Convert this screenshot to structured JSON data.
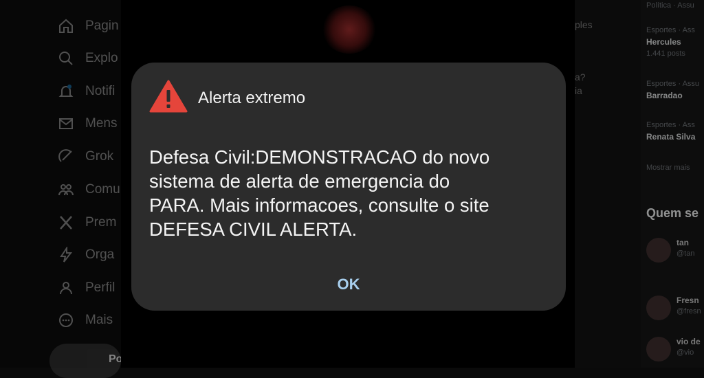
{
  "background": {
    "nav": [
      {
        "label": "Pagin",
        "icon": "home-icon"
      },
      {
        "label": "Explo",
        "icon": "search-icon"
      },
      {
        "label": "Notifi",
        "icon": "bell-icon"
      },
      {
        "label": "Mens",
        "icon": "mail-icon"
      },
      {
        "label": "Grok",
        "icon": "grok-icon"
      },
      {
        "label": "Comu",
        "icon": "communities-icon"
      },
      {
        "label": "Prem",
        "icon": "x-logo-icon"
      },
      {
        "label": "Orga",
        "icon": "lightning-icon"
      },
      {
        "label": "Perfil",
        "icon": "profile-icon"
      },
      {
        "label": "Mais",
        "icon": "more-icon"
      }
    ],
    "post_button_label": "Po",
    "mid_fragments": [
      "ples",
      "a?",
      "ia"
    ],
    "trends": [
      {
        "meta": "Política · Assu",
        "name": "",
        "count": ""
      },
      {
        "meta": "Esportes · Ass",
        "name": "Hercules",
        "count": "1.441 posts"
      },
      {
        "meta": "Esportes · Assu",
        "name": "Barradao",
        "count": ""
      },
      {
        "meta": "Esportes · Ass",
        "name": "Renata Silva",
        "count": ""
      },
      {
        "meta": "Mostrar mais",
        "name": "",
        "count": ""
      }
    ],
    "who_to_follow_title": "Quem se",
    "follow": [
      {
        "name": "tan",
        "handle": "@tan"
      },
      {
        "name": "Fresn",
        "handle": "@fresn"
      },
      {
        "name": "vio de",
        "handle": "@vio"
      }
    ]
  },
  "alert": {
    "title": "Alerta extremo",
    "icon": "warning-triangle-icon",
    "icon_color": "#e5453b",
    "body_lines": [
      "Defesa Civil:DEMONSTRACAO do novo",
      "sistema de alerta de emergencia do",
      "PARA. Mais informacoes, consulte o site",
      "DEFESA CIVIL ALERTA."
    ],
    "ok_label": "OK",
    "accent_color": "#a8cfee"
  }
}
